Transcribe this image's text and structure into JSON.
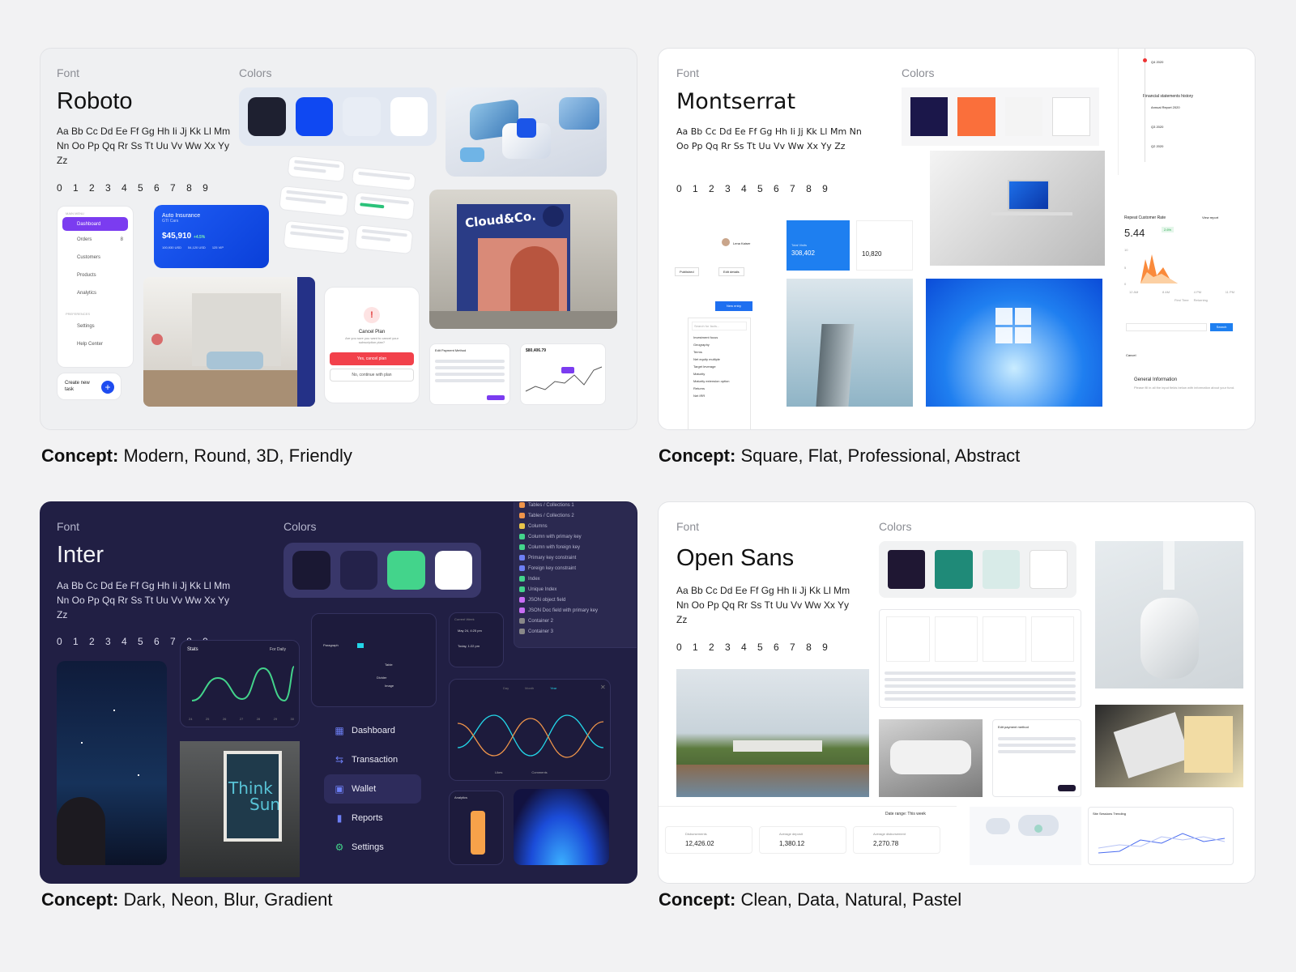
{
  "labels": {
    "font": "Font",
    "colors": "Colors",
    "concept_prefix": "Concept:"
  },
  "cards": [
    {
      "font_name": "Roboto",
      "alphabet": "Aa Bb Cc Dd Ee Ff Gg Hh Ii Jj Kk Ll Mm Nn Oo Pp Qq Rr Ss Tt Uu Vv Ww Xx Yy Zz",
      "numbers": "0 1 2 3 4 5 6 7 8 9",
      "colors": [
        "#1e2030",
        "#0f48f2",
        "#e8edf5",
        "#ffffff"
      ],
      "concept": "Modern, Round, 3D, Friendly",
      "menu": {
        "header": "MAIN MENU",
        "items": [
          "Dashboard",
          "Orders",
          "Customers",
          "Products",
          "Analytics"
        ],
        "orders_badge": "8",
        "pref_header": "PREFERENCES",
        "pref_items": [
          "Settings",
          "Help Center"
        ]
      },
      "insurance": {
        "title": "Auto Insurance",
        "subtitle": "GTI Cars",
        "amount": "$45,910",
        "change": "+4.5%",
        "stats": [
          "100,930 USD",
          "54,120 USD",
          "125 VIP"
        ]
      },
      "create_task": "Create new task",
      "storefront_sign": "Cloud&Co.",
      "cancel_plan": {
        "title": "Cancel Plan",
        "text": "Are you sure you want to cancel your subscription plan?",
        "confirm": "Yes, cancel plan",
        "decline": "No, continue with plan"
      },
      "payment_title": "Edit Payment Method",
      "price_card": {
        "value": "$80,406.79"
      }
    },
    {
      "font_name": "Montserrat",
      "alphabet": "Aa Bb Cc Dd Ee Ff Gg Hh Ii Jj Kk Ll Mm Nn Oo Pp Qq Rr Ss Tt Uu Vv Ww Xx Yy Zz",
      "numbers": "0 1 2 3 4 5 6 7 8 9",
      "colors": [
        "#1b174a",
        "#fa6f3b",
        "#f4f4f4",
        "#ffffff"
      ],
      "concept": "Square, Flat, Professional, Abstract",
      "timeline": {
        "title": "Financial statements history",
        "items": [
          "Annual Report 2020",
          "Q3 2020",
          "Q2 2020"
        ],
        "top_items": [
          "Q4 2020"
        ]
      },
      "repeat_rate": {
        "title": "Repeat Customer Rate",
        "link": "View report",
        "value": "5.44",
        "change": "2.6%",
        "legend": [
          "First Time",
          "Returning"
        ],
        "x_ticks": [
          "12 AM",
          "8 AM",
          "4 PM",
          "11 PM"
        ],
        "y_ticks": [
          "10",
          "5",
          "0"
        ]
      },
      "visits": {
        "label": "Total Visits",
        "value": "308,402",
        "value2": "10,820"
      },
      "profile": {
        "name": "Lena Kaiser"
      },
      "buttons": {
        "published": "Published",
        "edit": "Edit details",
        "new_entry": "New entry",
        "search": "Search"
      },
      "filter_items": [
        "Investment focus",
        "Geography",
        "Terms",
        "Net equity multiple",
        "Target leverage",
        "Maturity",
        "Maturity extension option",
        "Returns",
        "Net IRR"
      ],
      "search_placeholder": "Search for facts...",
      "general_info": {
        "cancel": "Cancel",
        "title": "General Information",
        "text": "Please fill in all the input fields below with information about your fund."
      }
    },
    {
      "font_name": "Inter",
      "alphabet": "Aa Bb Cc Dd Ee Ff Gg Hh Ii Jj Kk Ll Mm Nn Oo Pp Qq Rr Ss Tt Uu Vv Ww Xx Yy Zz",
      "numbers": "0 1 2 3 4 5 6 7 8 9",
      "colors": [
        "#1a1833",
        "#24224a",
        "#43d48b",
        "#ffffff"
      ],
      "concept": "Dark, Neon, Blur, Gradient",
      "nav": [
        "Dashboard",
        "Transaction",
        "Wallet",
        "Reports",
        "Settings"
      ],
      "stats": {
        "title": "Stats",
        "period": "For Daily",
        "days": [
          "24",
          "25",
          "26",
          "27",
          "28",
          "29",
          "30"
        ]
      },
      "poster": {
        "line1": "Think",
        "line2": "Sun"
      },
      "editor": {
        "style": "Paragraph",
        "table": "Table",
        "divider": "Divider",
        "image": "Image"
      },
      "tree": [
        "Tables / Collections 1",
        "Tables / Collections 2",
        "Columns",
        "Column with primary key",
        "Column with foreign key",
        "Primary key constraint",
        "Foreign key constraint",
        "Index",
        "Unique Index",
        "JSON object field",
        "JSON Doc field with primary key",
        "Container 2",
        "Container 3"
      ],
      "events": [
        {
          "date": "May 24, 4:25 pm"
        },
        {
          "date": "Today, 1:22 pm"
        }
      ],
      "events_header": "Current Week",
      "chart_tabs": [
        "Day",
        "Month",
        "Year"
      ],
      "chart_legend": [
        "Likes",
        "Comments"
      ],
      "analytics": "Analytics"
    },
    {
      "font_name": "Open Sans",
      "alphabet": "Aa Bb Cc Dd Ee Ff Gg Hh Ii Jj Kk Ll Mm Nn Oo Pp Qq Rr Ss Tt Uu Vv Ww Xx Yy Zz",
      "numbers": "0 1 2 3 4 5 6 7 8 9",
      "colors": [
        "#1f1733",
        "#1f8a78",
        "#d8ebe8",
        "#ffffff"
      ],
      "concept": "Clean, Data, Natural, Pastel",
      "kpis": [
        {
          "label": "Disbursements",
          "value": "12,426.02"
        },
        {
          "label": "Average deposit",
          "value": "1,380.12"
        },
        {
          "label": "Average disbursement",
          "value": "2,270.78"
        }
      ],
      "date_range": "Date range: This week",
      "payment_title": "Edit payment method",
      "sessions_title": "Site Sessions Trending"
    }
  ]
}
